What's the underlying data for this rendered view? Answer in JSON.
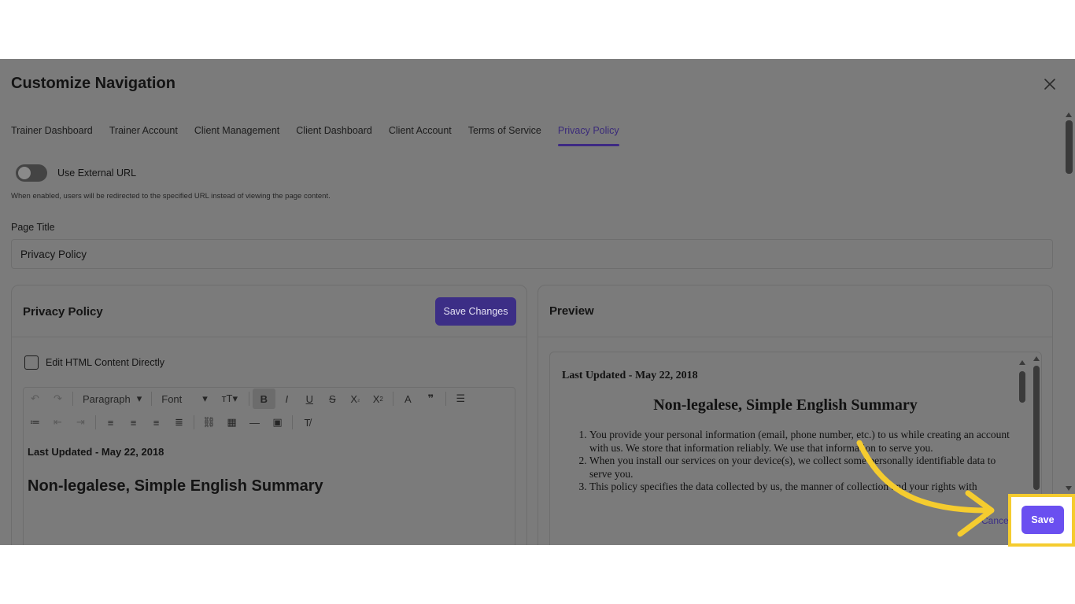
{
  "dialog": {
    "title": "Customize Navigation",
    "close_icon": "close-icon"
  },
  "tabs": [
    {
      "label": "Trainer Dashboard",
      "active": false
    },
    {
      "label": "Trainer Account",
      "active": false
    },
    {
      "label": "Client Management",
      "active": false
    },
    {
      "label": "Client Dashboard",
      "active": false
    },
    {
      "label": "Client Account",
      "active": false
    },
    {
      "label": "Terms of Service",
      "active": false
    },
    {
      "label": "Privacy Policy",
      "active": true
    }
  ],
  "external_url": {
    "label": "Use External URL",
    "enabled": false,
    "help": "When enabled, users will be redirected to the specified URL instead of viewing the page content."
  },
  "page_title": {
    "label": "Page Title",
    "value": "Privacy Policy"
  },
  "editor_panel": {
    "title": "Privacy Policy",
    "save_changes_label": "Save Changes",
    "edit_html_label": "Edit HTML Content Directly",
    "edit_html_checked": false,
    "toolbar": {
      "paragraph_select": "Paragraph",
      "font_select": "Font"
    },
    "content": {
      "updated": "Last Updated - May 22, 2018",
      "heading": "Non-legalese, Simple English Summary"
    }
  },
  "preview_panel": {
    "title": "Preview",
    "updated": "Last Updated - May 22, 2018",
    "heading": "Non-legalese, Simple English Summary",
    "items": [
      "You provide your personal information (email, phone number, etc.) to us while creating an account with us. We store that information reliably. We use that information to serve you.",
      "When you install our services on your device(s), we collect some personally identifiable data to serve you.",
      "This policy specifies the data collected by us, the manner of collection and your rights with"
    ]
  },
  "footer": {
    "cancel_label": "Cancel",
    "save_label": "Save"
  },
  "colors": {
    "accent": "#3d2a83",
    "save_button": "#6a4ff0",
    "highlight": "#f5cc2f",
    "overlay": "#7b7b7b"
  }
}
